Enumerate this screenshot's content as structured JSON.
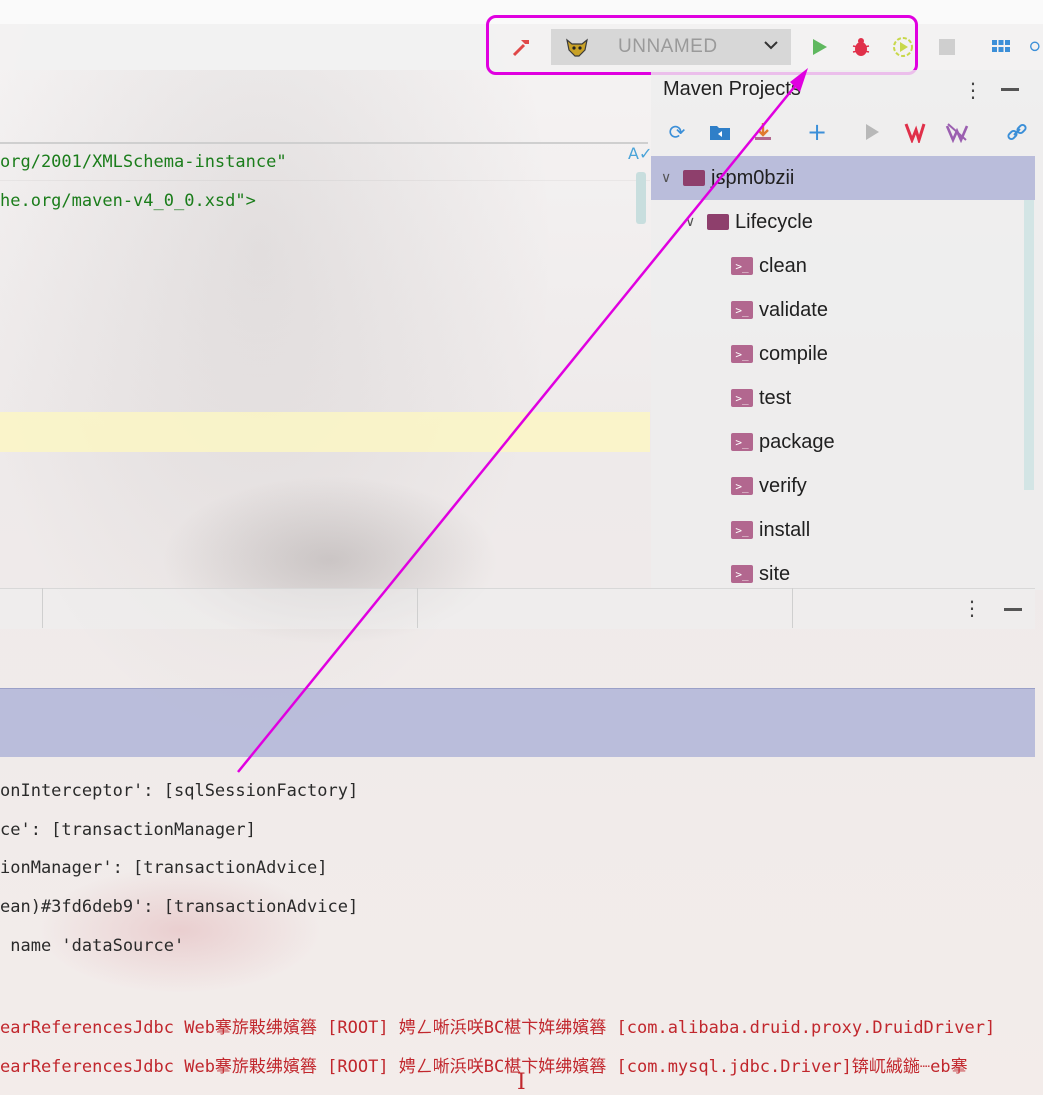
{
  "toolbar": {
    "build_icon": "hammer-icon",
    "run_config": {
      "icon": "tomcat-icon",
      "name": "UNNAMED"
    },
    "run_icon": "play-icon",
    "debug_icon": "bug-icon",
    "coverage_icon": "run-with-coverage-icon",
    "stop_icon": "stop-icon",
    "layout_icon": "grid-layout-icon",
    "highlight_color": "#e000e0"
  },
  "editor": {
    "lines": [
      {
        "text": "org/2001/XMLSchema-instance\""
      },
      {
        "text": "he.org/maven-v4_0_0.xsd\">"
      }
    ]
  },
  "maven": {
    "title": "Maven Projects",
    "toolbar_icons": [
      "reimport-icon",
      "generate-sources-icon",
      "download-icon",
      "add-icon",
      "run-maven-build-icon",
      "maven-goal-icon",
      "toggle-offline-icon",
      "show-dependencies-icon"
    ],
    "project": "jspm0bzii",
    "lifecycle_label": "Lifecycle",
    "goals": [
      "clean",
      "validate",
      "compile",
      "test",
      "package",
      "verify",
      "install",
      "site"
    ]
  },
  "console": {
    "lines": [
      {
        "text": "onInterceptor': [sqlSessionFactory]",
        "color": "#2a2a2a"
      },
      {
        "text": "ce': [transactionManager]",
        "color": "#2a2a2a"
      },
      {
        "text": "ionManager': [transactionAdvice]",
        "color": "#2a2a2a"
      },
      {
        "text": "ean)#3fd6deb9': [transactionAdvice]",
        "color": "#2a2a2a"
      },
      {
        "text": " name 'dataSource'",
        "color": "#2a2a2a"
      },
      {
        "text": "earReferencesJdbc Web搴旂敤绋嬪簭 [ROOT] 娉ㄥ唽浜咲BC椹卞姩绋嬪簭 [com.alibaba.druid.proxy.DruidDriver]",
        "color": "#c1272d"
      },
      {
        "text": "earReferencesJdbc Web搴旂敤绋嬪簭 [ROOT] 娉ㄥ唽浜咲BC椹卞姩绋嬪簭 [com.mysql.jdbc.Driver]锛屼絾鍦┈eb搴",
        "color": "#c1272d"
      }
    ]
  }
}
